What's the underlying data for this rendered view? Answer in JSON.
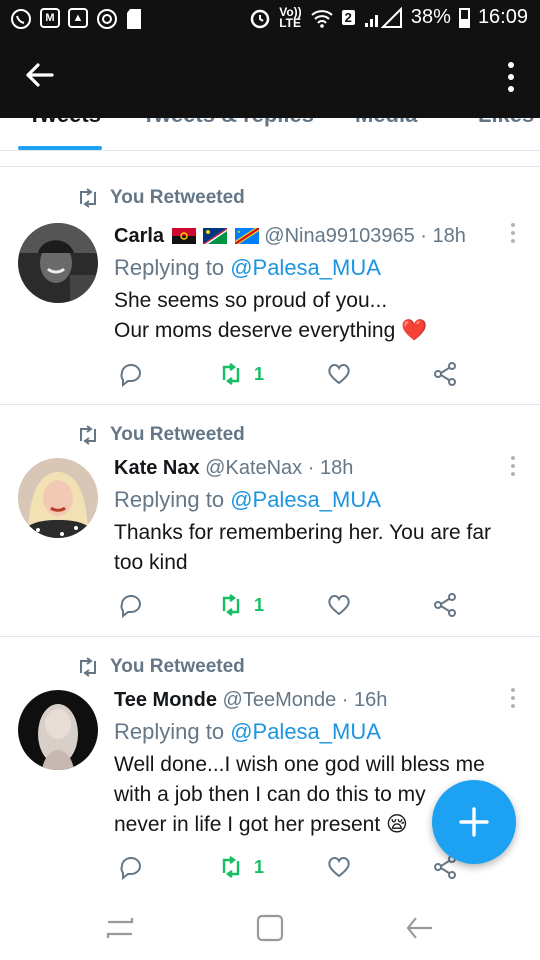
{
  "status_bar": {
    "left_icons": [
      "whatsapp-icon",
      "gmail-icon",
      "gallery-icon",
      "target-icon",
      "sdcard-icon"
    ],
    "right_icons": [
      "alarm-icon",
      "volte-icon",
      "wifi-icon",
      "sim-badge",
      "signal-icon",
      "battery-icon"
    ],
    "volte_label_top": "Vo))",
    "volte_label_bottom": "LTE",
    "sim_badge": "2",
    "battery": "38%",
    "time": "16:09"
  },
  "tabs": [
    {
      "label": "Tweets",
      "active": true
    },
    {
      "label": "Tweets & replies",
      "active": false
    },
    {
      "label": "Media",
      "active": false
    },
    {
      "label": "Likes",
      "active": false
    }
  ],
  "tweets": [
    {
      "retweet_label": "You Retweeted",
      "name": "Carla",
      "flags": [
        "angola-flag",
        "namibia-flag",
        "drc-flag"
      ],
      "handle": "@Nina99103965",
      "time": "· 18h",
      "replying_prefix": "Replying to ",
      "replying_to": "@Palesa_MUA",
      "text_lines": [
        "She seems so proud of you...",
        "Our moms deserve everything ❤️"
      ],
      "retweet_count": "1"
    },
    {
      "retweet_label": "You Retweeted",
      "name": "Kate Nax",
      "flags": [],
      "handle": "@KateNax",
      "time": "· 18h",
      "replying_prefix": "Replying to ",
      "replying_to": "@Palesa_MUA",
      "text_lines": [
        "Thanks for remembering her. You are far",
        "too kind"
      ],
      "retweet_count": "1"
    },
    {
      "retweet_label": "You Retweeted",
      "name": "Tee Monde",
      "flags": [],
      "handle": "@TeeMonde",
      "time": "· 16h",
      "replying_prefix": "Replying to ",
      "replying_to": "@Palesa_MUA",
      "text_lines": [
        "Well done...I wish one god will bless me",
        "with a job then I can do this to my",
        "never in life I got her present 😪"
      ],
      "retweet_count": "1"
    }
  ],
  "colors": {
    "accent": "#1da1f2",
    "link": "#1b95e0",
    "retweet_green": "#17bf63",
    "secondary_text": "#657786",
    "header_bg": "#111111",
    "heart_red": "#e0245e"
  }
}
